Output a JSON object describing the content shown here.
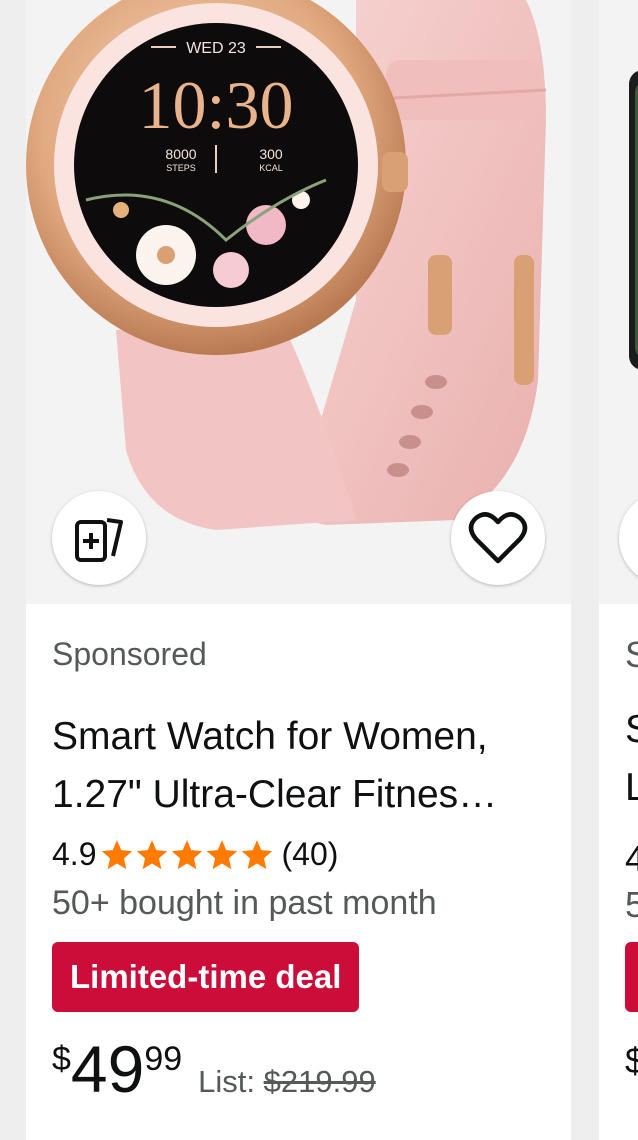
{
  "product": {
    "sponsored_label": "Sponsored",
    "title_line1": "Smart Watch for Women,",
    "title_line2": "1.27\" Ultra-Clear Fitnes…",
    "rating": "4.9",
    "rating_stars": 5,
    "review_count": "(40)",
    "bought": "50+ bought in past month",
    "deal_badge": "Limited-time deal",
    "price_currency": "$",
    "price_whole": "49",
    "price_fraction": "99",
    "list_label": "List:",
    "list_price": "$219.99",
    "watch_face": {
      "date": "WED 23",
      "time": "10:30",
      "steps_value": "8000",
      "steps_label": "STEPS",
      "kcal_value": "300",
      "kcal_label": "KCAL"
    }
  },
  "next_product_peek": {
    "sponsored_initial": "S",
    "title_initial1": "S",
    "title_initial2": "L",
    "rating_initial": "4",
    "bought_initial": "5",
    "price_initial": "$"
  },
  "colors": {
    "deal_red": "#cc0c39",
    "star_orange": "#ff7a00",
    "strap_pink": "#f2c4c3",
    "bezel_gold": "#d8a072"
  },
  "icons": {
    "compare": "compare-icon",
    "wishlist": "heart-icon"
  }
}
